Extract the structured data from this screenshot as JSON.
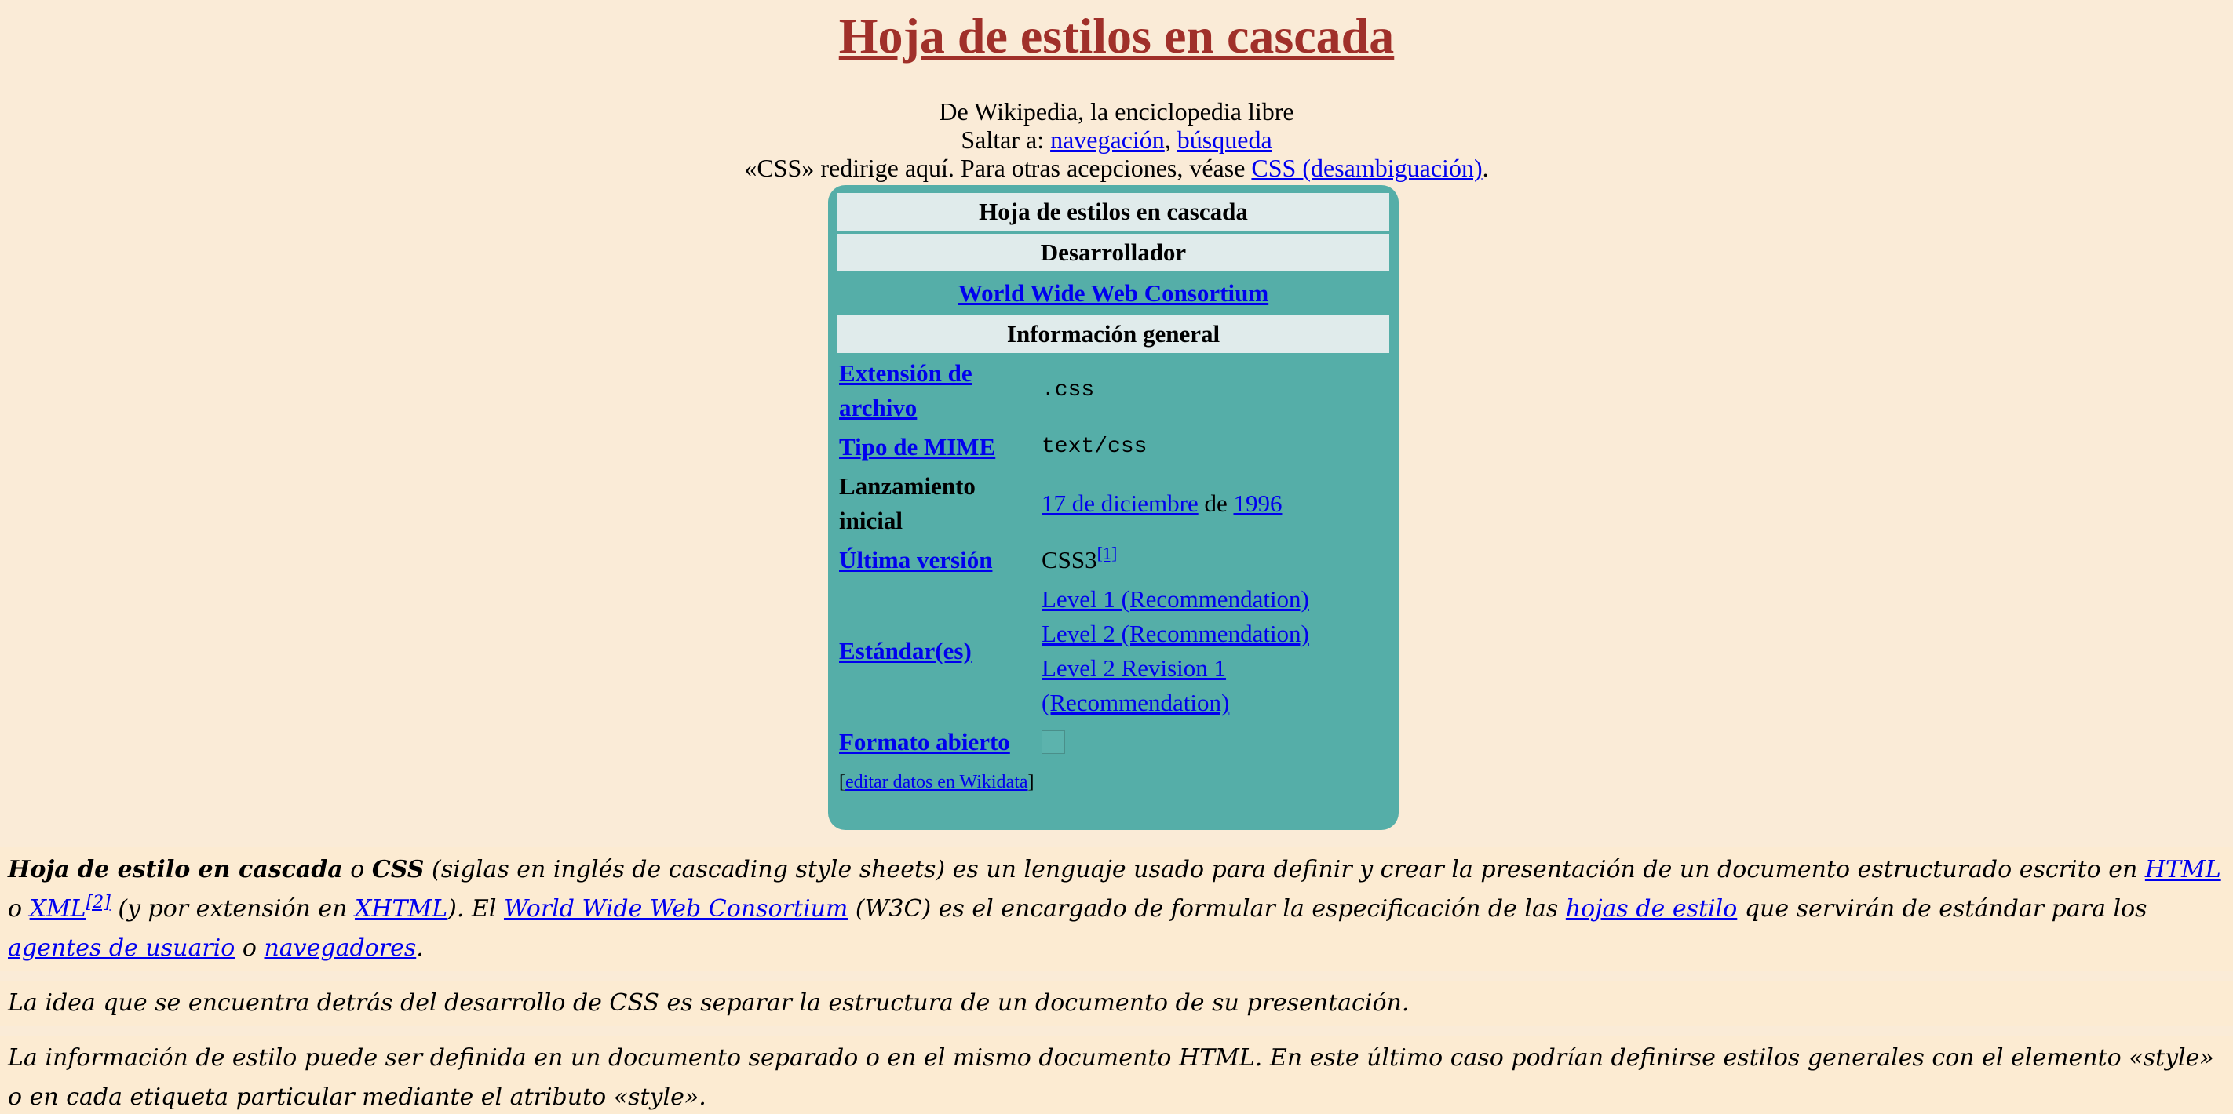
{
  "title": "Hoja de estilos en cascada",
  "intro": {
    "from": "De Wikipedia, la enciclopedia libre",
    "jump_prefix": "Saltar a: ",
    "jump_nav": "navegación",
    "jump_sep": ", ",
    "jump_search": "búsqueda",
    "redirect_text": "«CSS» redirige aquí. Para otras acepciones, véase ",
    "redirect_link": "CSS (desambiguación)",
    "redirect_end": "."
  },
  "infobox": {
    "header": "Hoja de estilos en cascada",
    "developer_header": "Desarrollador",
    "developer": "World Wide Web Consortium",
    "general_header": "Información general",
    "rows": {
      "extension_label": "Extensión de archivo",
      "extension_value": ".css",
      "mime_label": "Tipo de MIME",
      "mime_value": "text/css",
      "release_label": "Lanzamiento inicial",
      "release_date": "17 de diciembre",
      "release_de": " de ",
      "release_year": "1996",
      "version_label": "Última versión",
      "version_value": "CSS3",
      "version_ref": "[1]",
      "standards_label": "Estándar(es)",
      "standards": [
        "Level 1 (Recommendation)",
        "Level 2 (Recommendation)",
        "Level 2 Revision 1",
        "(Recommendation)"
      ],
      "open_label": "Formato abierto"
    },
    "wikidata_open": "[",
    "wikidata_link": "editar datos en Wikidata",
    "wikidata_close": "]"
  },
  "article": {
    "p1": {
      "bold": "Hoja de estilo en cascada",
      "t1": " o ",
      "css": "CSS",
      "t2": " (siglas en inglés de ",
      "en": "cascading style sheets",
      "t3": ") es un lenguaje usado para definir y crear la presentación de un documento estructurado escrito en ",
      "html": "HTML",
      "t4": " o ",
      "xml": "XML",
      "ref2": "[2]",
      "t5": " (y por extensión en ",
      "xhtml": "XHTML",
      "t6": "). El ",
      "w3c": "World Wide Web Consortium",
      "t7": " (W3C) es el encargado de formular la especificación de las ",
      "hojas": "hojas de estilo",
      "t8": " que servirán de estándar para los ",
      "agentes": "agentes de usuario",
      "t9": " o ",
      "navegadores": "navegadores",
      "t10": "."
    },
    "p2": "La idea que se encuentra detrás del desarrollo de CSS es separar la estructura de un documento de su presentación.",
    "p3": "La información de estilo puede ser definida en un documento separado o en el mismo documento HTML. En este último caso podrían definirse estilos generales con el elemento «style» o en cada etiqueta particular mediante el atributo «style»."
  },
  "colors": {
    "background": "#faebd7",
    "title": "#a0302a",
    "infobox": "#55aea8",
    "infobox_header": "#e0ebeb",
    "link": "#0000ee"
  }
}
